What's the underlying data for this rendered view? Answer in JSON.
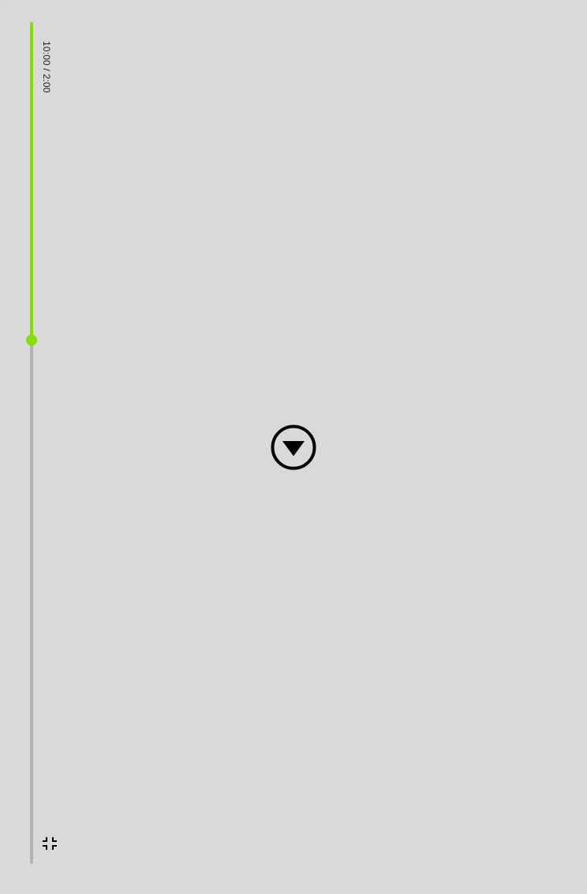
{
  "player": {
    "time_display": "10:00 / 2:00",
    "progress_fraction": 0.378,
    "colors": {
      "background": "#d9d9d9",
      "track": "#b3b3b3",
      "accent": "#84df00",
      "icon": "#000000"
    }
  },
  "controls": {
    "play_icon": "play-circle-icon",
    "fullscreen_icon": "exit-fullscreen-icon"
  }
}
